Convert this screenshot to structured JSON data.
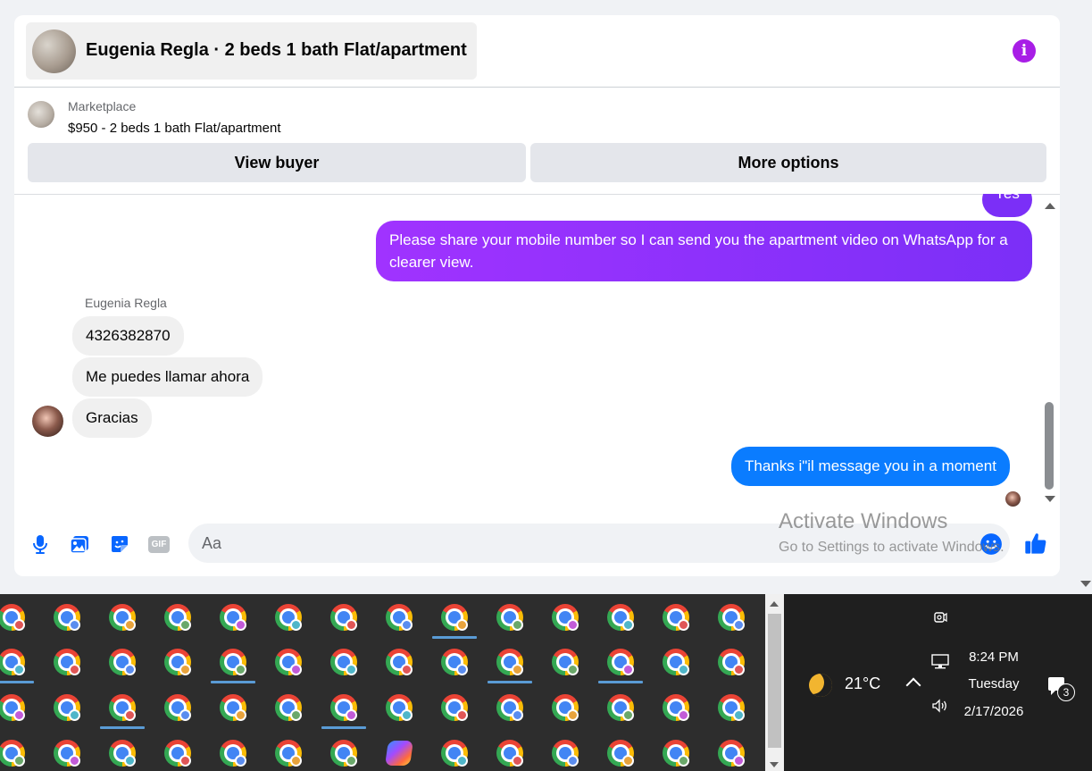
{
  "conversation": {
    "header_title": "Eugenia Regla · 2 beds 1 bath Flat/apartment",
    "info_icon": "i"
  },
  "listing": {
    "source": "Marketplace",
    "title": "$950 - 2 beds 1 bath Flat/apartment",
    "buttons": {
      "view_buyer": "View buyer",
      "more_options": "More options"
    }
  },
  "thread": {
    "out_partial": "Yes",
    "out_message_1": "Please share your mobile number so I can send you the apartment video on WhatsApp for a clearer view.",
    "sender_name": "Eugenia Regla",
    "in_messages": [
      "4326382870",
      "Me puedes llamar ahora",
      "Gracias"
    ],
    "out_message_2": "Thanks i\"il message you in a moment"
  },
  "composer": {
    "placeholder": "Aa",
    "gif_label": "GIF",
    "icons": [
      "microphone-icon",
      "photo-icon",
      "sticker-icon",
      "gif-icon",
      "emoji-icon",
      "thumbs-up-icon"
    ]
  },
  "watermark": {
    "line1": "Activate Windows",
    "line2": "Go to Settings to activate Windows."
  },
  "taskbar": {
    "weather_temp": "21°C",
    "clock_time": "8:24 PM",
    "clock_day": "Tuesday",
    "clock_date": "2/17/2026",
    "notifications_count": "3"
  },
  "colors": {
    "outgoing_gradient_start": "#a033ff",
    "outgoing_gradient_end": "#7b2ff7",
    "outgoing_blue": "#0a7cff",
    "incoming_bubble": "#f0f0f0",
    "accent_blue": "#0866ff",
    "info_purple": "#a81ee6"
  }
}
